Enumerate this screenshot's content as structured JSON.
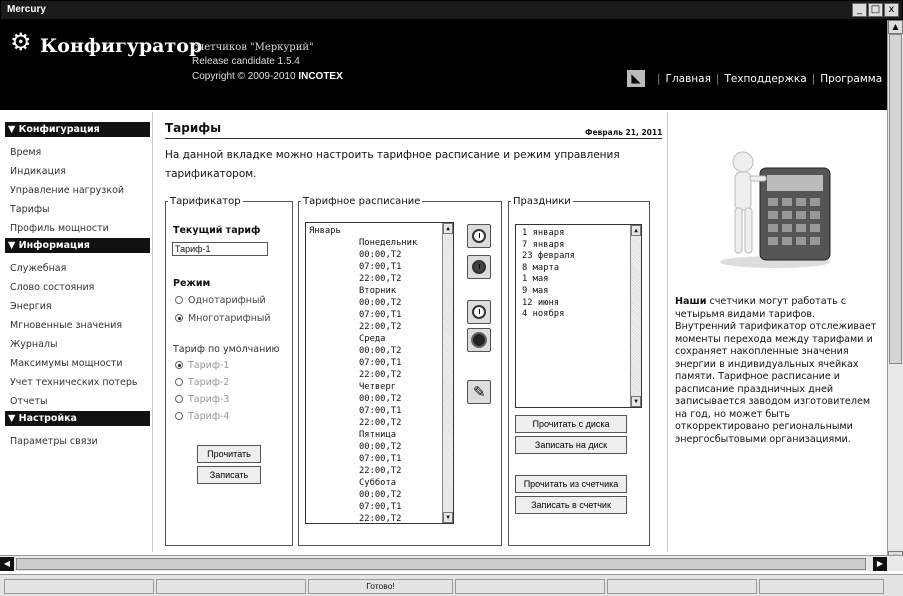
{
  "window": {
    "title": "Mercury",
    "controls": [
      "_",
      "□",
      "x"
    ]
  },
  "header": {
    "brand": "Конфигуратор",
    "subtitle": "счетчиков \"Меркурий\"",
    "release": "Release candidate 1.5.4",
    "copyright": "Copyright © 2009-2010",
    "company": "INCOTEX",
    "nav": [
      "Главная",
      "Техподдержка",
      "Программа"
    ]
  },
  "sidebar": {
    "sections": [
      {
        "title": "▼ Конфигурация",
        "items": [
          "Время",
          "Индикация",
          "Управление нагрузкой",
          "Тарифы",
          "Профиль мощности"
        ]
      },
      {
        "title": "▼ Информация",
        "items": [
          "Служебная",
          "Слово состояния",
          "Энергия",
          "Мгновенные значения",
          "Журналы",
          "Максимумы мощности",
          "Учет технических потерь",
          "Отчеты"
        ]
      },
      {
        "title": "▼ Настройка",
        "items": [
          "Параметры связи"
        ]
      }
    ]
  },
  "page": {
    "title": "Тарифы",
    "date": "Февраль 21, 2011",
    "intro": "На данной вкладке можно настроить тарифное расписание и режим управления тарификатором."
  },
  "tarifikator": {
    "legend": "Тарификатор",
    "current_label": "Текущий тариф",
    "current_value": "Тариф-1",
    "mode_label": "Режим",
    "modes": [
      "Однотарифный",
      "Многотарифный"
    ],
    "mode_selected": 1,
    "default_label": "Тариф по умолчанию",
    "defaults": [
      "Тариф-1",
      "Тариф-2",
      "Тариф-3",
      "Тариф-4"
    ],
    "read_button": "Прочитать",
    "write_button": "Записать"
  },
  "schedule": {
    "legend": "Тарифное расписание",
    "lines": [
      {
        "t": "Январь",
        "indent": 0
      },
      {
        "t": "Понедельник",
        "indent": 2
      },
      {
        "t": "00:00,Т2",
        "indent": 2
      },
      {
        "t": "07:00,Т1",
        "indent": 2
      },
      {
        "t": "22:00,Т2",
        "indent": 2
      },
      {
        "t": "Вторник",
        "indent": 2
      },
      {
        "t": "00:00,Т2",
        "indent": 2
      },
      {
        "t": "07:00,Т1",
        "indent": 2
      },
      {
        "t": "22:00,Т2",
        "indent": 2
      },
      {
        "t": "Среда",
        "indent": 2
      },
      {
        "t": "00:00,Т2",
        "indent": 2
      },
      {
        "t": "07:00,Т1",
        "indent": 2
      },
      {
        "t": "22:00,Т2",
        "indent": 2
      },
      {
        "t": "Четверг",
        "indent": 2
      },
      {
        "t": "00:00,Т2",
        "indent": 2
      },
      {
        "t": "07:00,Т1",
        "indent": 2
      },
      {
        "t": "22:00,Т2",
        "indent": 2
      },
      {
        "t": "Пятница",
        "indent": 2
      },
      {
        "t": "00:00,Т2",
        "indent": 2
      },
      {
        "t": "07:00,Т1",
        "indent": 2
      },
      {
        "t": "22:00,Т2",
        "indent": 2
      },
      {
        "t": "Суббота",
        "indent": 2
      },
      {
        "t": "00:00,Т2",
        "indent": 2
      },
      {
        "t": "07:00,Т1",
        "indent": 2
      },
      {
        "t": "22:00,Т2",
        "indent": 2
      }
    ]
  },
  "holidays": {
    "legend": "Праздники",
    "items": [
      "1 января",
      "7 января",
      "23 февраля",
      "8 марта",
      "1 мая",
      "9 мая",
      "12 июня",
      "4 ноября"
    ],
    "buttons": [
      "Прочитать с диска",
      "Записать на диск",
      "Прочитать из счетчика",
      "Записать в счетчик"
    ]
  },
  "description": {
    "bold": "Наши",
    "text": " счетчики могут работать с четырьмя видами тарифов. Внутренний тарификатор отслеживает моменты перехода между тарифами и сохраняет накопленные значения энергии в индивидуальных ячейках памяти. Тарифное расписание и расписание праздничных дней записывается заводом изготовителем на год, но может быть откорректировано региональными энергосбытовыми организациями."
  },
  "status": {
    "text": "Готово!"
  }
}
